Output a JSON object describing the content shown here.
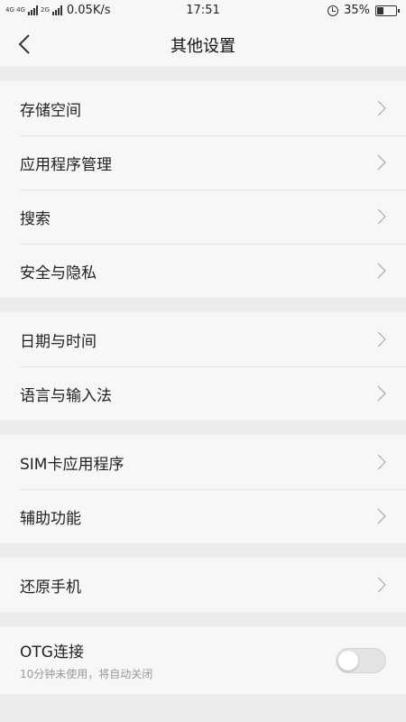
{
  "status_bar": {
    "network_top": "4G 4G",
    "network_second": "2G",
    "speed": "0.05K/s",
    "time": "17:51",
    "battery": "35%",
    "battery_level": 0.35
  },
  "header": {
    "title": "其他设置"
  },
  "groups": [
    {
      "items": [
        {
          "label": "存储空间"
        },
        {
          "label": "应用程序管理"
        },
        {
          "label": "搜索"
        },
        {
          "label": "安全与隐私"
        }
      ]
    },
    {
      "items": [
        {
          "label": "日期与时间"
        },
        {
          "label": "语言与输入法"
        }
      ]
    },
    {
      "items": [
        {
          "label": "SIM卡应用程序"
        },
        {
          "label": "辅助功能"
        }
      ]
    },
    {
      "items": [
        {
          "label": "还原手机"
        }
      ]
    }
  ],
  "otg": {
    "label": "OTG连接",
    "subtitle": "10分钟未使用，将自动关闭",
    "enabled": false
  }
}
